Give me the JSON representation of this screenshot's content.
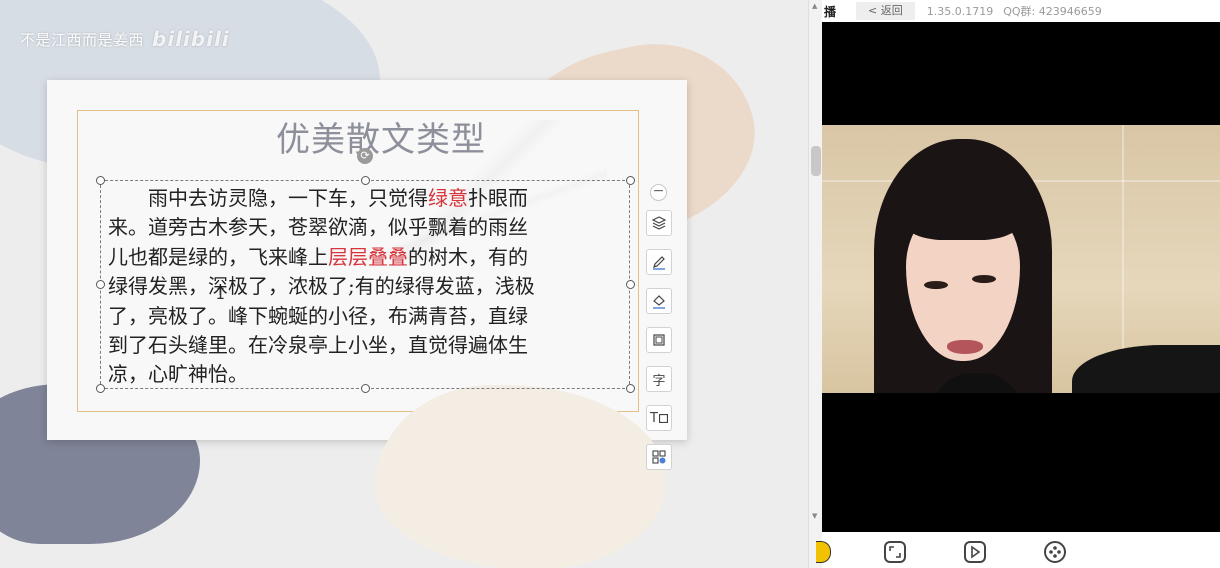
{
  "watermark": {
    "text": "不是江西而是姜西",
    "logo": "bilibili"
  },
  "slide": {
    "title": "优美散文类型",
    "paragraph_lines": [
      [
        {
          "t": "　　雨中去访灵隐，一下车，只觉得"
        },
        {
          "t": "绿意",
          "hl": true
        },
        {
          "t": "扑眼而"
        }
      ],
      [
        {
          "t": "来。道旁古木参天，苍翠欲滴，似乎飘着的雨丝"
        }
      ],
      [
        {
          "t": "儿也都是绿的，飞来峰上"
        },
        {
          "t": "层层叠叠",
          "hl": true
        },
        {
          "t": "的树木，有的"
        }
      ],
      [
        {
          "t": "绿得发黑，深极了，浓极了;有的绿得发蓝，浅极"
        }
      ],
      [
        {
          "t": "了，亮极了。峰下蜿蜒的小径，布满青苔，直绿"
        }
      ],
      [
        {
          "t": "到了石头缝里。在冷泉亭上小坐，直觉得遍体生"
        }
      ],
      [
        {
          "t": "凉，心旷神怡。"
        }
      ]
    ],
    "highlight_color": "#d8343c"
  },
  "side_toolbar": {
    "collapse_icon": "minus-icon",
    "tools": [
      {
        "name": "layers-icon"
      },
      {
        "name": "pen-icon"
      },
      {
        "name": "fill-icon"
      },
      {
        "name": "border-icon"
      },
      {
        "name": "font-icon",
        "label": "字"
      },
      {
        "name": "text-box-icon",
        "label": "T"
      },
      {
        "name": "arrange-icon"
      }
    ]
  },
  "stream_panel": {
    "app_label": "播",
    "back_label": "< 返回",
    "version": "1.35.0.1719",
    "qq_group": "QQ群: 423946659"
  }
}
